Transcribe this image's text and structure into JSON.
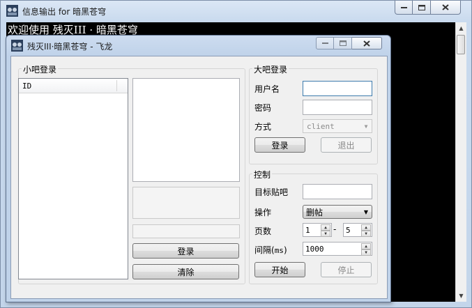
{
  "outer": {
    "title": "信息输出 for 暗黑苍穹",
    "console_text": "欢迎使用 残灭III · 暗黑苍穹"
  },
  "dialog": {
    "title": "残灭III·暗黑苍穹 - 飞龙",
    "small_login": {
      "group_label": "小吧登录",
      "list_column": "ID",
      "login_button": "登录",
      "clear_button": "清除"
    },
    "big_login": {
      "group_label": "大吧登录",
      "username_label": "用户名",
      "username_value": "",
      "password_label": "密码",
      "password_value": "",
      "method_label": "方式",
      "method_value": "client",
      "login_button": "登录",
      "logout_button": "退出"
    },
    "control": {
      "group_label": "控制",
      "target_label": "目标贴吧",
      "target_value": "",
      "operation_label": "操作",
      "operation_value": "删帖",
      "pages_label": "页数",
      "page_from": "1",
      "page_sep": "-",
      "page_to": "5",
      "interval_label_prefix": "间隔(",
      "interval_label_unit": "ms",
      "interval_label_suffix": ")",
      "interval_value": "1000",
      "start_button": "开始",
      "stop_button": "停止"
    }
  },
  "colors": {
    "console_bg": "#000000",
    "console_fg": "#ffffff",
    "dialog_bg": "#f0f0f0",
    "frame": "#bfd2e9"
  }
}
